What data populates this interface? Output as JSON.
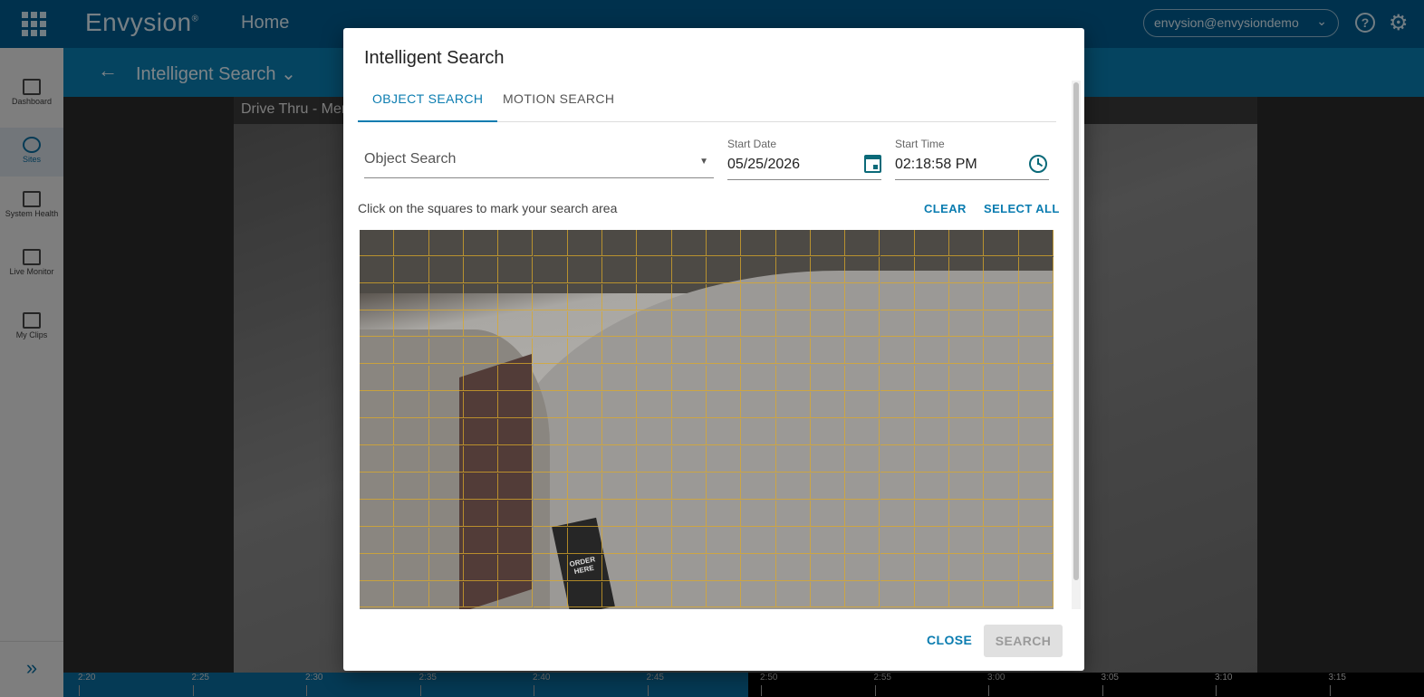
{
  "topbar": {
    "brand": "Envysion",
    "brand_mark": "®",
    "home_label": "Home",
    "user_email": "envysion@envysiondemo",
    "user_chevron": "⌄",
    "help_glyph": "?",
    "gear_glyph": "⚙"
  },
  "subheader": {
    "back_glyph": "←",
    "title": "Intelligent Search ⌄"
  },
  "leftnav": {
    "items": [
      {
        "label": "Dashboard",
        "icon": "dashboard-icon"
      },
      {
        "label": "Sites",
        "icon": "globe-icon"
      },
      {
        "label": "System Health",
        "icon": "system-health-icon"
      },
      {
        "label": "Live Monitor",
        "icon": "play-icon"
      },
      {
        "label": "My Clips",
        "icon": "clapper-icon"
      }
    ],
    "expand_glyph": "»"
  },
  "video": {
    "camera_title": "Drive Thru - Men"
  },
  "timeline": {
    "ticks": [
      "2:20",
      "2:25",
      "2:30",
      "2:35",
      "2:40",
      "2:45",
      "2:50",
      "2:55",
      "3:00",
      "3:05",
      "3:10",
      "3:15"
    ]
  },
  "dialog": {
    "title": "Intelligent Search",
    "tabs": [
      {
        "label": "OBJECT SEARCH",
        "active": true
      },
      {
        "label": "MOTION SEARCH",
        "active": false
      }
    ],
    "object_search_placeholder": "Object Search",
    "object_search_caret": "▼",
    "start_date_label": "Start Date",
    "start_date_value": "05/25/2026",
    "start_time_label": "Start Time",
    "start_time_value": "02:18:58 PM",
    "hint": "Click on the squares to mark your search area",
    "clear_label": "CLEAR",
    "select_all_label": "SELECT ALL",
    "order_sign_text": "ORDER HERE",
    "close_label": "CLOSE",
    "search_label": "SEARCH"
  },
  "colors": {
    "topbar": "#005a8c",
    "subbar": "#0a7cb0",
    "accent": "#0a7cb0",
    "grid_line": "#dcaa28",
    "icon_teal": "#0b6a79"
  }
}
